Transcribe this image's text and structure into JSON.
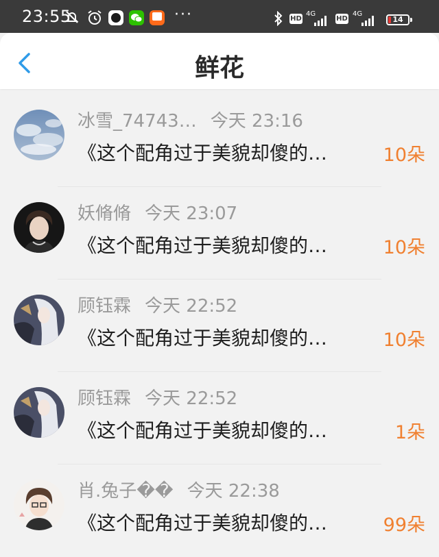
{
  "status_bar": {
    "time": "23:55",
    "battery": "14",
    "battery_level": 0.14,
    "network_label_1": "4G",
    "network_label_2": "4G",
    "hd_1": "HD",
    "hd_2": "HD",
    "more": "···",
    "icons": [
      "alarm-off-icon",
      "alarm-clock-icon",
      "app-icon",
      "wechat-icon",
      "calendar-app-icon",
      "bluetooth-icon",
      "signal-icon",
      "battery-icon"
    ]
  },
  "header": {
    "title": "鲜花",
    "back_icon": "chevron-left-icon"
  },
  "colors": {
    "accent_orange": "#f08030",
    "back_blue": "#2f9be8",
    "status_bg": "#3a3a3a"
  },
  "items": [
    {
      "user": "冰雪_74743…",
      "time": "今天 23:16",
      "title": "《这个配角过于美貌却傻的…",
      "count": "10朵"
    },
    {
      "user": "妖脩脩",
      "time": "今天 23:07",
      "title": "《这个配角过于美貌却傻的…",
      "count": "10朵"
    },
    {
      "user": "顾钰霖",
      "time": "今天 22:52",
      "title": "《这个配角过于美貌却傻的…",
      "count": "10朵"
    },
    {
      "user": "顾钰霖",
      "time": "今天 22:52",
      "title": "《这个配角过于美貌却傻的…",
      "count": "1朵"
    },
    {
      "user": "肖.兔子��",
      "time": "今天 22:38",
      "title": "《这个配角过于美貌却傻的…",
      "count": "99朵"
    }
  ]
}
